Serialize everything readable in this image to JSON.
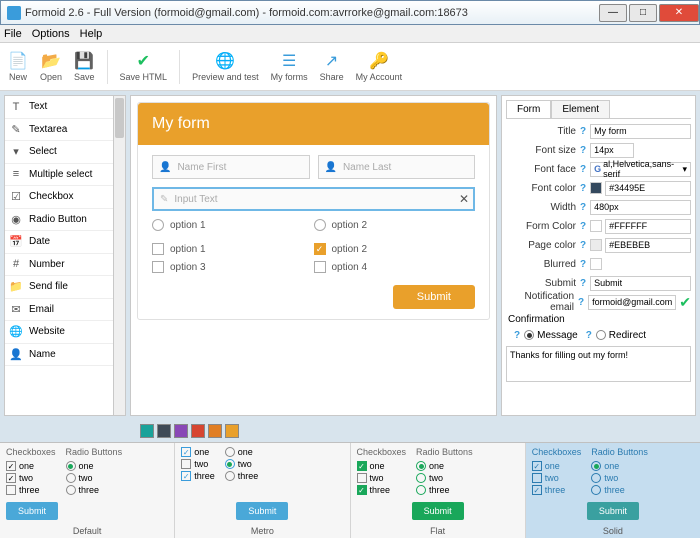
{
  "window": {
    "title": "Formoid 2.6 - Full Version (formoid@gmail.com) - formoid.com:avrrorke@gmail.com:18673"
  },
  "menu": {
    "file": "File",
    "options": "Options",
    "help": "Help"
  },
  "toolbar": {
    "new": "New",
    "open": "Open",
    "save": "Save",
    "savehtml": "Save HTML",
    "preview": "Preview and test",
    "myforms": "My forms",
    "share": "Share",
    "account": "My Account"
  },
  "palette": [
    {
      "icon": "T",
      "label": "Text"
    },
    {
      "icon": "✎",
      "label": "Textarea"
    },
    {
      "icon": "▾",
      "label": "Select"
    },
    {
      "icon": "≡",
      "label": "Multiple select"
    },
    {
      "icon": "☑",
      "label": "Checkbox"
    },
    {
      "icon": "◉",
      "label": "Radio Button"
    },
    {
      "icon": "📅",
      "label": "Date"
    },
    {
      "icon": "#",
      "label": "Number"
    },
    {
      "icon": "📁",
      "label": "Send file"
    },
    {
      "icon": "✉",
      "label": "Email"
    },
    {
      "icon": "🌐",
      "label": "Website"
    },
    {
      "icon": "👤",
      "label": "Name"
    }
  ],
  "form": {
    "title": "My form",
    "name_first": "Name First",
    "name_last": "Name Last",
    "input_text": "Input Text",
    "radio1": "option 1",
    "radio2": "option 2",
    "chk1": "option 1",
    "chk2": "option 2",
    "chk3": "option 3",
    "chk4": "option 4",
    "submit": "Submit"
  },
  "props": {
    "tab_form": "Form",
    "tab_element": "Element",
    "title_lbl": "Title",
    "title_val": "My form",
    "fontsize_lbl": "Font size",
    "fontsize_val": "14px",
    "fontface_lbl": "Font face",
    "fontface_val": "al,Helvetica,sans-serif",
    "fontcolor_lbl": "Font color",
    "fontcolor_val": "#34495E",
    "width_lbl": "Width",
    "width_val": "480px",
    "formcolor_lbl": "Form Color",
    "formcolor_val": "#FFFFFF",
    "pagecolor_lbl": "Page color",
    "pagecolor_val": "#EBEBEB",
    "blurred_lbl": "Blurred",
    "submit_lbl": "Submit",
    "submit_val": "Submit",
    "email_lbl": "Notification email",
    "email_val": "formoid@gmail.com",
    "confirm_lbl": "Confirmation",
    "msg_lbl": "Message",
    "redirect_lbl": "Redirect",
    "msg_val": "Thanks for filling out my form!"
  },
  "swatches": [
    "#1aa29a",
    "#3f4a56",
    "#8948b6",
    "#d64530",
    "#e07e24",
    "#e9a02b"
  ],
  "themes": {
    "chk_head": "Checkboxes",
    "rad_head": "Radio Buttons",
    "one": "one",
    "two": "two",
    "three": "three",
    "submit": "Submit",
    "default": "Default",
    "metro": "Metro",
    "flat": "Flat",
    "solid": "Solid"
  }
}
